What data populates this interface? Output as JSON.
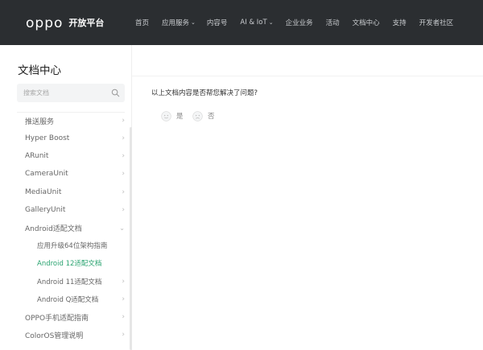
{
  "header": {
    "logo_text": "oppo",
    "logo_sub": "开放平台",
    "nav": [
      {
        "label": "首页",
        "dropdown": false
      },
      {
        "label": "应用服务",
        "dropdown": true
      },
      {
        "label": "内容号",
        "dropdown": false
      },
      {
        "label": "AI & IoT",
        "dropdown": true
      },
      {
        "label": "企业业务",
        "dropdown": false
      },
      {
        "label": "活动",
        "dropdown": false
      },
      {
        "label": "文档中心",
        "dropdown": false
      },
      {
        "label": "支持",
        "dropdown": false
      },
      {
        "label": "开发者社区",
        "dropdown": false
      }
    ]
  },
  "sidebar": {
    "title": "文档中心",
    "search_placeholder": "搜索文档",
    "items": [
      {
        "label": "推送服务",
        "level": 1,
        "expanded": false
      },
      {
        "label": "Hyper Boost",
        "level": 1,
        "expanded": false
      },
      {
        "label": "ARunit",
        "level": 1,
        "expanded": false
      },
      {
        "label": "CameraUnit",
        "level": 1,
        "expanded": false
      },
      {
        "label": "MediaUnit",
        "level": 1,
        "expanded": false
      },
      {
        "label": "GalleryUnit",
        "level": 1,
        "expanded": false
      },
      {
        "label": "Android适配文档",
        "level": 1,
        "expanded": true
      },
      {
        "label": "应用升级64位架构指南",
        "level": 2,
        "expanded": false
      },
      {
        "label": "Android 12适配文档",
        "level": 2,
        "expanded": false,
        "active": true
      },
      {
        "label": "Android 11适配文档",
        "level": 2,
        "expanded": false
      },
      {
        "label": "Android Q适配文档",
        "level": 2,
        "expanded": false
      },
      {
        "label": "OPPO手机适配指南",
        "level": 1,
        "expanded": false
      },
      {
        "label": "ColorOS管理说明",
        "level": 1,
        "expanded": false
      }
    ]
  },
  "main": {
    "question": "以上文档内容是否帮您解决了问题?",
    "yes_label": "是",
    "no_label": "否"
  },
  "colors": {
    "header_bg": "#2b2e31",
    "accent": "#2ba471"
  }
}
